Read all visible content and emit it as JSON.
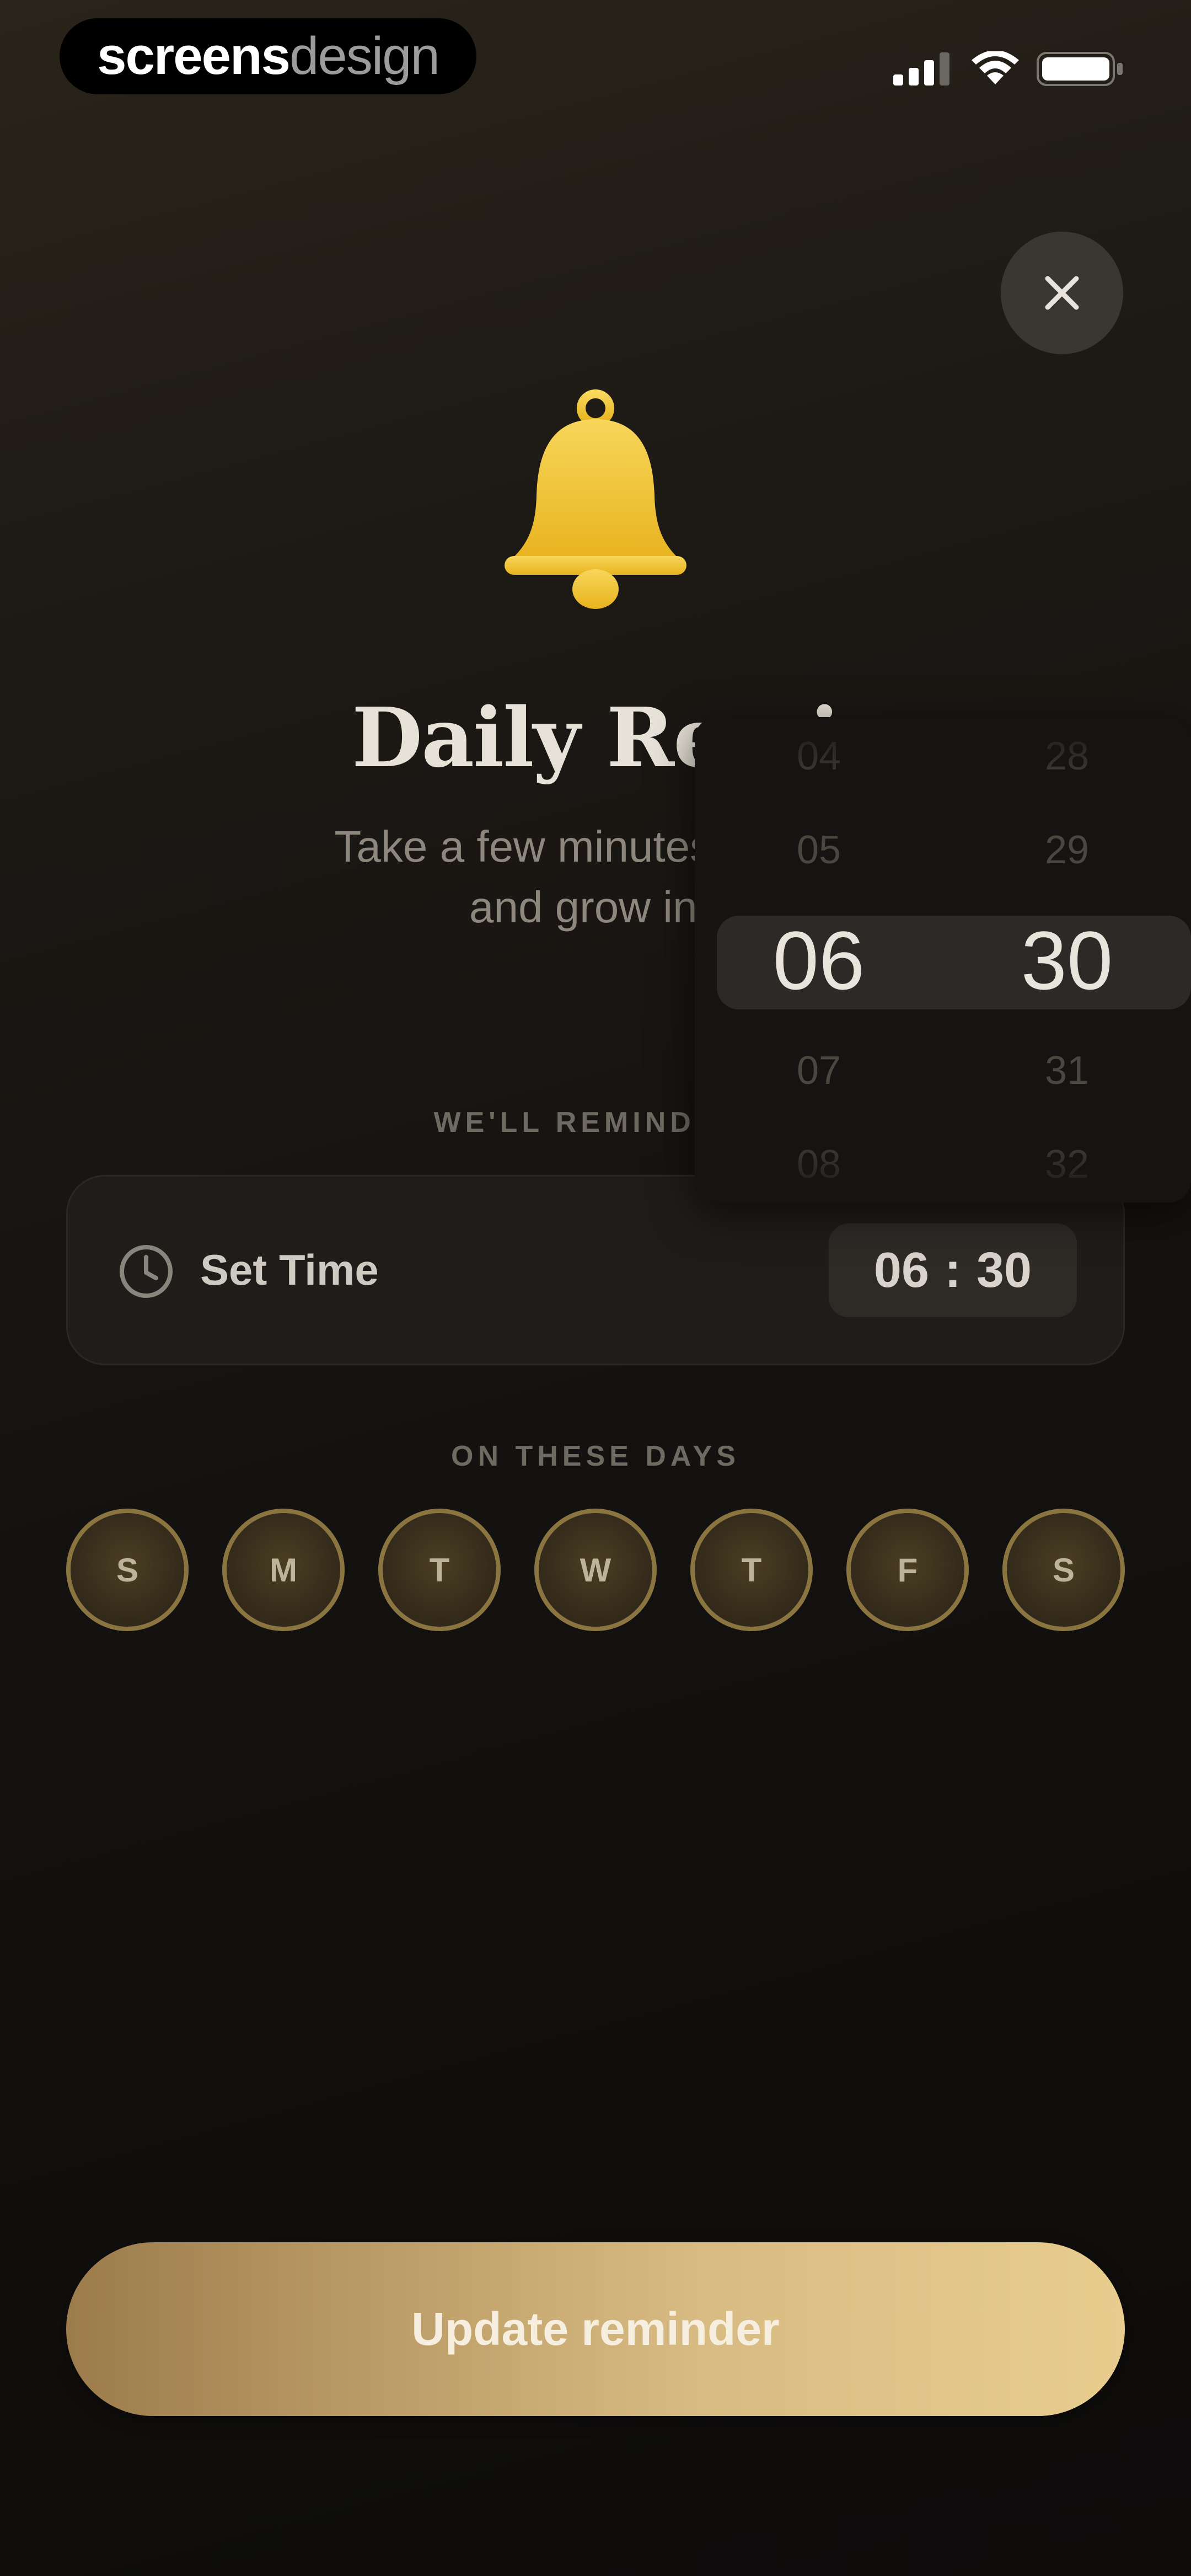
{
  "status_bar": {
    "brand_part1": "screens",
    "brand_part2": "design",
    "icons": [
      "signal-icon",
      "wifi-icon",
      "battery-icon"
    ]
  },
  "header": {
    "close_icon": "close-icon",
    "bell_icon": "bell-icon",
    "title": "Daily Remi",
    "subtitle_line1": "Take a few minutes each d",
    "subtitle_line2": "and grow in f"
  },
  "remind": {
    "section_label": "WE'LL REMIND YO",
    "set_time_label": "Set Time",
    "clock_icon": "clock-icon",
    "hour": "06",
    "separator": ":",
    "minute": "30"
  },
  "picker": {
    "hours": [
      "04",
      "05",
      "06",
      "07",
      "08"
    ],
    "minutes": [
      "28",
      "29",
      "30",
      "31",
      "32"
    ],
    "selected_index": 2
  },
  "days": {
    "section_label": "ON THESE DAYS",
    "items": [
      "S",
      "M",
      "T",
      "W",
      "T",
      "F",
      "S"
    ]
  },
  "footer": {
    "button_label": "Update reminder"
  },
  "colors": {
    "accent_gold": "#d8bb82",
    "bell_gold": "#f2c43a",
    "background": "#141210"
  }
}
